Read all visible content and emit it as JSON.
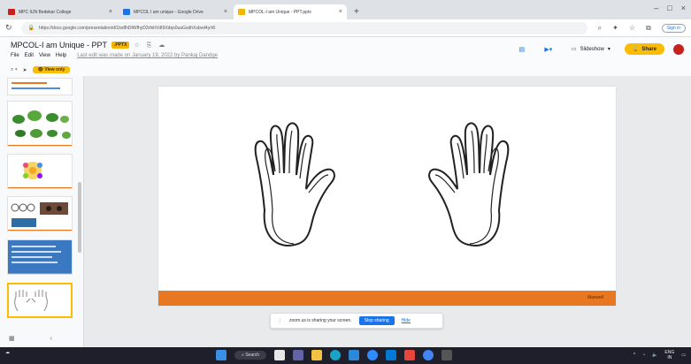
{
  "browser": {
    "tabs": [
      {
        "title": "MPC IUN Bedekar College",
        "active": false,
        "favicon_color": "#c5221f"
      },
      {
        "title": "MPCOL I am unique - Google Drive",
        "active": false,
        "favicon_color": "#1a73e8"
      },
      {
        "title": "MPCOL-I am Unique - PPT.pptx",
        "active": true,
        "favicon_color": "#f4b400"
      }
    ],
    "new_tab": "+",
    "url": "https://docs.google.com/presentation/d/1bx8hDtWfhyD3rfxhVdI9Xdqx0uaGsdhXsbvd4y/r8",
    "sign_in": "Sign in"
  },
  "slides_app": {
    "doc_title": "MPCOL-I am Unique - PPT",
    "file_badge": ".PPTX",
    "menu": [
      "File",
      "Edit",
      "View",
      "Help"
    ],
    "last_edit": "Last edit was made on January 19, 2022 by Pankaj Dandge",
    "slideshow_label": "Slideshow",
    "share_label": "Share",
    "view_only_label": "View only",
    "accent": "#fbbc04"
  },
  "canvas": {
    "footer_logo": "Maxwell",
    "footer_color": "#e87722"
  },
  "share_notice": {
    "text": "zoom.us is sharing your screen.",
    "stop_label": "Stop sharing",
    "hide_label": "Hide"
  },
  "taskbar": {
    "search_label": "Search",
    "language": "ENG",
    "region": "IN"
  }
}
